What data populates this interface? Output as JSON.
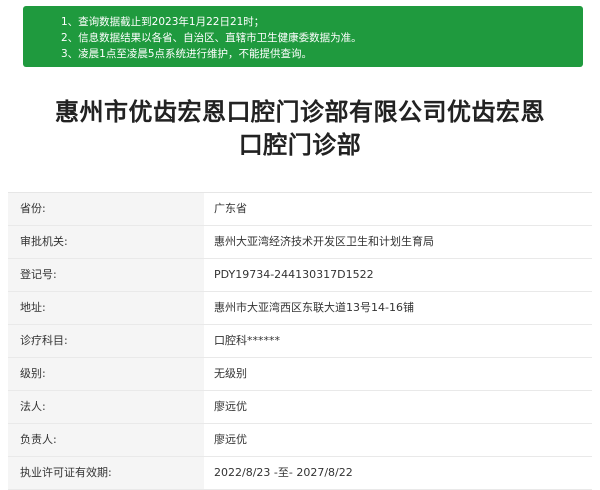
{
  "notice": {
    "lines": [
      "1、查询数据截止到2023年1月22日21时；",
      "2、信息数据结果以各省、自治区、直辖市卫生健康委数据为准。",
      "3、凌晨1点至凌晨5点系统进行维护，不能提供查询。"
    ]
  },
  "title": {
    "line1": "惠州市优齿宏恩口腔门诊部有限公司优齿宏恩",
    "line2": "口腔门诊部"
  },
  "rows": [
    {
      "label": "省份:",
      "value": "广东省"
    },
    {
      "label": "审批机关:",
      "value": "惠州大亚湾经济技术开发区卫生和计划生育局"
    },
    {
      "label": "登记号:",
      "value": "PDY19734-244130317D1522"
    },
    {
      "label": "地址:",
      "value": "惠州市大亚湾西区东联大道13号14-16铺"
    },
    {
      "label": "诊疗科目:",
      "value": "口腔科******"
    },
    {
      "label": "级别:",
      "value": "无级别"
    },
    {
      "label": "法人:",
      "value": "廖远优"
    },
    {
      "label": "负责人:",
      "value": "廖远优"
    },
    {
      "label": "执业许可证有效期:",
      "value": "2022/8/23 -至- 2027/8/22"
    }
  ]
}
